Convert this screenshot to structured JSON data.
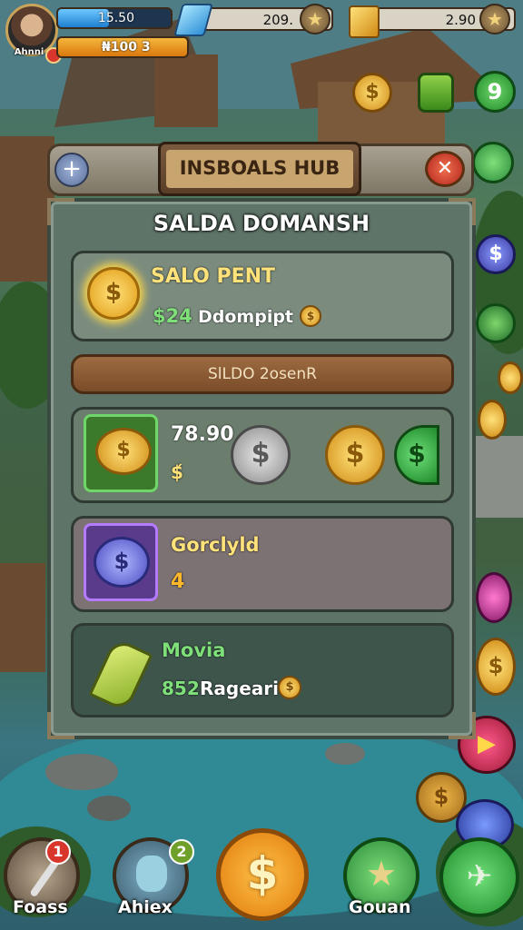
{
  "hud": {
    "player_name": "Ahnni",
    "xp_text": "15.50",
    "xp_fill": 0.45,
    "gold_text": "₦100 3",
    "gem_value": "209.",
    "gold_value": "2.90"
  },
  "hub": {
    "title": "INSBOALS HUB",
    "panel_title": "SALDA DOMANSH",
    "card1": {
      "title": "SALO PENT",
      "value": "$24",
      "label": "Ddompipt"
    },
    "subheader": "SlLDO 2osenR",
    "card2": {
      "value": "78.90",
      "sub": "$́"
    },
    "card3": {
      "title": "Gorclyld",
      "value": "4"
    },
    "card4": {
      "title": "Movia",
      "value": "852",
      "label": "Ragearit"
    }
  },
  "nav": {
    "left_label": "Foass",
    "left_badge": "1",
    "char_label": "Ahiex",
    "char_badge": "2",
    "right_label": "Gouan"
  },
  "icons": {
    "side_top": "$",
    "side_next": "9"
  }
}
